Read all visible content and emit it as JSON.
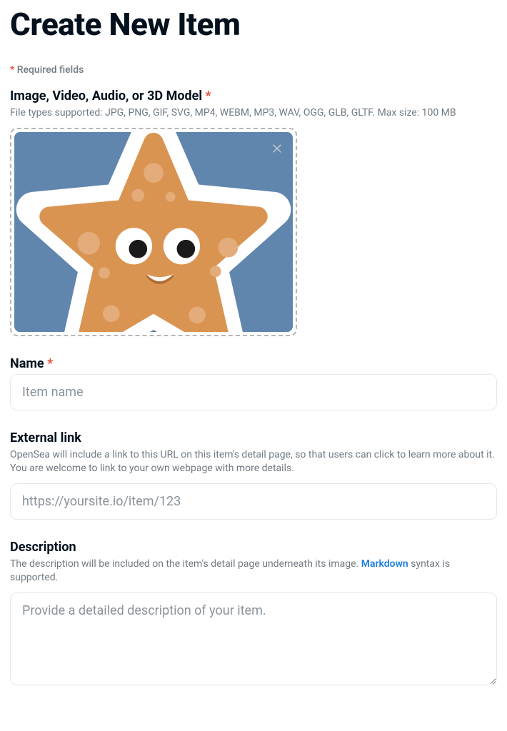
{
  "page": {
    "title": "Create New Item",
    "required_note_star": "*",
    "required_note_text": " Required fields"
  },
  "media": {
    "label": "Image, Video, Audio, or 3D Model ",
    "required": "*",
    "help": "File types supported: JPG, PNG, GIF, SVG, MP4, WEBM, MP3, WAV, OGG, GLB, GLTF. Max size: 100 MB"
  },
  "name": {
    "label": "Name ",
    "required": "*",
    "placeholder": "Item name",
    "value": ""
  },
  "external_link": {
    "label": "External link",
    "help": "OpenSea will include a link to this URL on this item's detail page, so that users can click to learn more about it. You are welcome to link to your own webpage with more details.",
    "placeholder": "https://yoursite.io/item/123",
    "value": ""
  },
  "description": {
    "label": "Description",
    "help_pre": "The description will be included on the item's detail page underneath its image. ",
    "help_link": "Markdown",
    "help_post": " syntax is supported.",
    "placeholder": "Provide a detailed description of your item.",
    "value": ""
  }
}
